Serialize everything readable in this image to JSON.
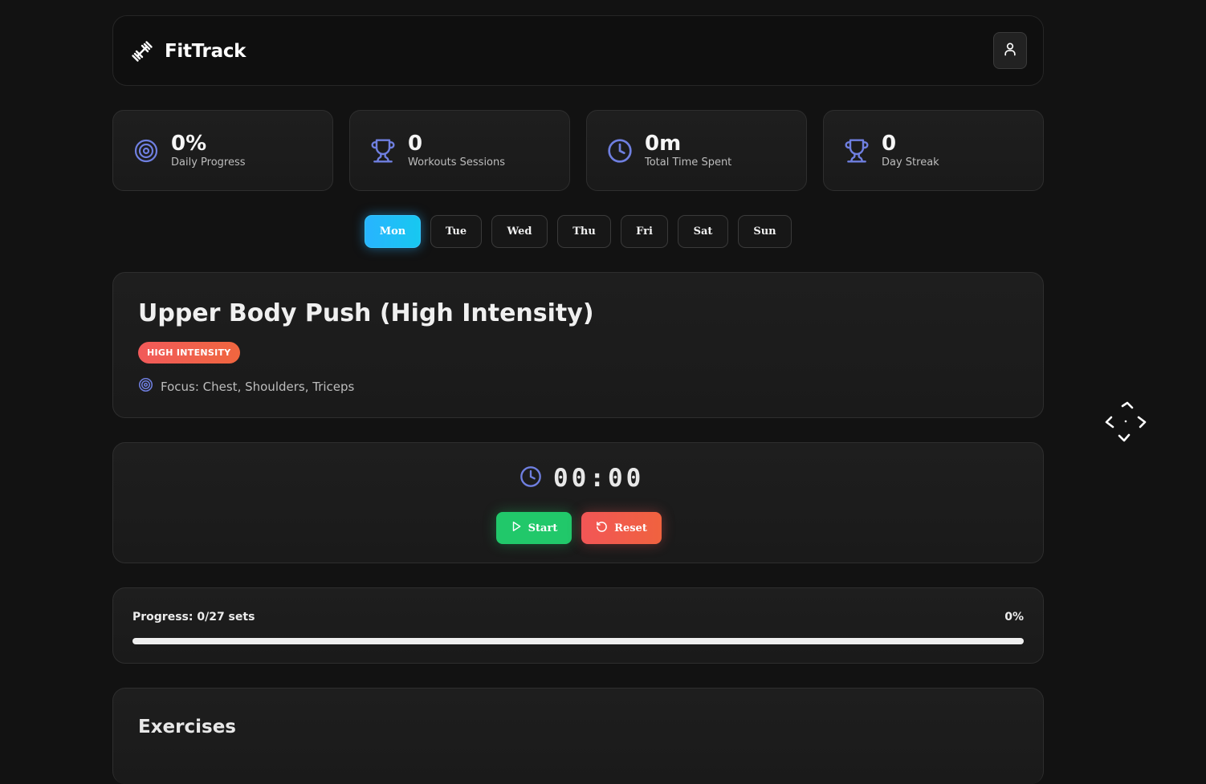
{
  "app": {
    "name": "FitTrack"
  },
  "stats": [
    {
      "value": "0%",
      "label": "Daily Progress",
      "icon": "target-icon"
    },
    {
      "value": "0",
      "label": "Workouts Sessions",
      "icon": "trophy-icon"
    },
    {
      "value": "0m",
      "label": "Total Time Spent",
      "icon": "clock-icon"
    },
    {
      "value": "0",
      "label": "Day Streak",
      "icon": "trophy-icon"
    }
  ],
  "days": [
    "Mon",
    "Tue",
    "Wed",
    "Thu",
    "Fri",
    "Sat",
    "Sun"
  ],
  "selected_day": "Mon",
  "workout": {
    "title": "Upper Body Push (High Intensity)",
    "intensity": "HIGH INTENSITY",
    "focus": "Focus: Chest, Shoulders, Triceps"
  },
  "timer": {
    "display": "00:00",
    "start_label": "Start",
    "reset_label": "Reset"
  },
  "progress": {
    "label": "Progress: 0/27 sets",
    "percent_text": "0%",
    "fraction": 0
  },
  "exercises": {
    "title": "Exercises"
  },
  "colors": {
    "accent": "#28b4ff",
    "icon": "#6f7fe0",
    "start": "#21c86a",
    "reset": "#f25656",
    "background": "#121212"
  }
}
